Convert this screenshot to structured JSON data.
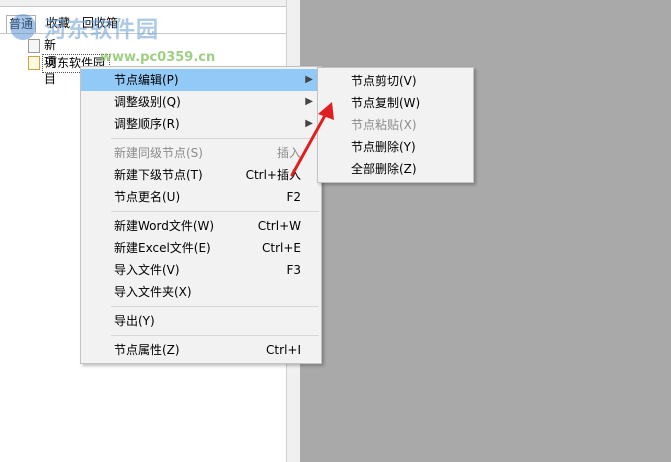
{
  "tabs": [
    {
      "label": "普通"
    },
    {
      "label": "收藏"
    },
    {
      "label": "回收箱"
    }
  ],
  "tree": [
    {
      "label": "新项目"
    },
    {
      "label": "河东软件园"
    }
  ],
  "watermark": {
    "main": "河东软件园",
    "url": "www.pc0359.cn"
  },
  "context_menu": {
    "items": [
      {
        "label": "节点编辑(P)",
        "shortcut": "",
        "submenu": true,
        "state": "hover"
      },
      {
        "label": "调整级别(Q)",
        "shortcut": "",
        "submenu": true,
        "state": "normal"
      },
      {
        "label": "调整顺序(R)",
        "shortcut": "",
        "submenu": true,
        "state": "normal"
      },
      {
        "label": "新建同级节点(S)",
        "shortcut": "插入",
        "submenu": false,
        "state": "disabled"
      },
      {
        "label": "新建下级节点(T)",
        "shortcut": "Ctrl+插入",
        "submenu": false,
        "state": "normal"
      },
      {
        "label": "节点更名(U)",
        "shortcut": "F2",
        "submenu": false,
        "state": "normal"
      },
      {
        "label": "新建Word文件(W)",
        "shortcut": "Ctrl+W",
        "submenu": false,
        "state": "normal"
      },
      {
        "label": "新建Excel文件(E)",
        "shortcut": "Ctrl+E",
        "submenu": false,
        "state": "normal"
      },
      {
        "label": "导入文件(V)",
        "shortcut": "F3",
        "submenu": false,
        "state": "normal"
      },
      {
        "label": "导入文件夹(X)",
        "shortcut": "",
        "submenu": false,
        "state": "normal"
      },
      {
        "label": "导出(Y)",
        "shortcut": "",
        "submenu": false,
        "state": "normal"
      },
      {
        "label": "节点属性(Z)",
        "shortcut": "Ctrl+I",
        "submenu": false,
        "state": "normal"
      }
    ]
  },
  "submenu": {
    "items": [
      {
        "label": "节点剪切(V)",
        "state": "normal"
      },
      {
        "label": "节点复制(W)",
        "state": "normal"
      },
      {
        "label": "节点粘贴(X)",
        "state": "disabled"
      },
      {
        "label": "节点删除(Y)",
        "state": "normal"
      },
      {
        "label": "全部删除(Z)",
        "state": "normal"
      }
    ]
  },
  "colors": {
    "menu_hover": "#91c9f7",
    "workspace": "#a9a9a9",
    "annotation_arrow": "#e02020"
  }
}
